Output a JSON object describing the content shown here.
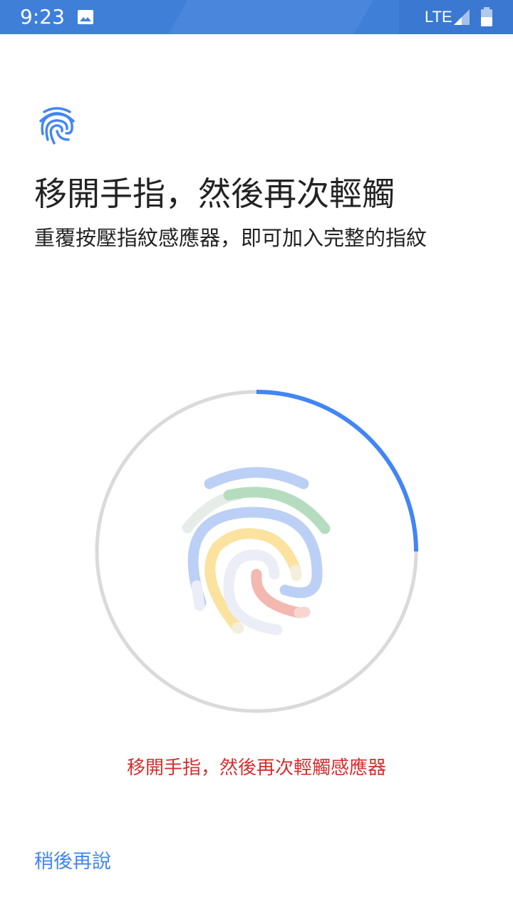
{
  "status_bar": {
    "time": "9:23",
    "network": "LTE",
    "icons": [
      "image-icon",
      "signal-icon",
      "battery-icon"
    ]
  },
  "header": {
    "icon": "fingerprint-icon",
    "title": "移開手指，然後再次輕觸",
    "subtitle": "重覆按壓指紋感應器，即可加入完整的指紋"
  },
  "enrollment": {
    "progress": 0.25,
    "message": "移開手指，然後再次輕觸感應器"
  },
  "footer": {
    "later_label": "稍後再說"
  },
  "colors": {
    "status_bar": "#3f7fd8",
    "accent": "#4285f4",
    "ring_track": "#dadada",
    "error": "#d32f2f",
    "text": "#222222"
  }
}
